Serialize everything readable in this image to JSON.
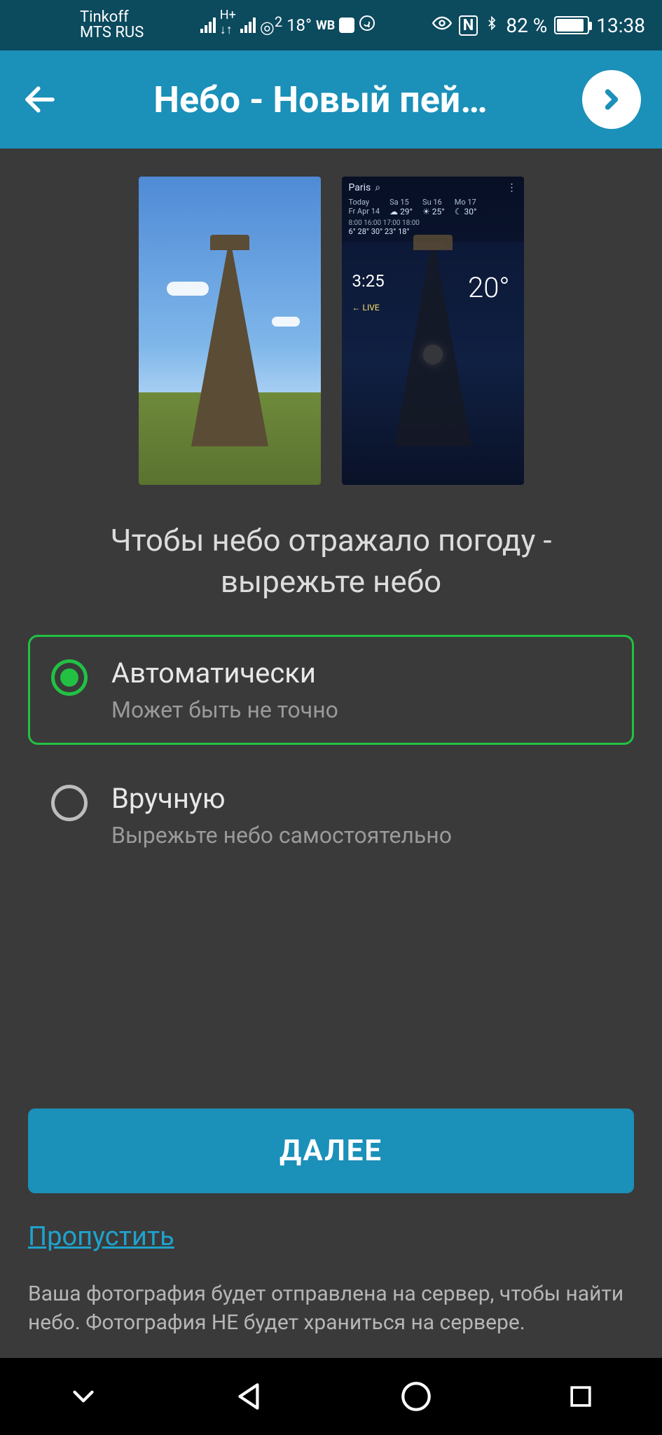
{
  "statusbar": {
    "carrier1": "Tinkoff",
    "carrier2": "MTS RUS",
    "temp_indicator": "18°",
    "wb_label": "WB",
    "battery_percent": "82 %",
    "time": "13:38",
    "aqi_badge_sup": "2"
  },
  "appbar": {
    "title": "Небо - Новый пей…"
  },
  "preview_night": {
    "location": "Paris",
    "today_label": "Today",
    "today_date": "Fr Apr 14",
    "days": [
      {
        "name": "Sa 15",
        "hi": "29°"
      },
      {
        "name": "Su 16",
        "hi": "25°"
      },
      {
        "name": "Mo 17",
        "hi": "30°"
      }
    ],
    "hours_row": "8:00   16:00   17:00   18:00",
    "hour_temps": "6° 28°  30°  23°  18°",
    "clock": "3:25",
    "live": "← LIVE",
    "big_temp": "20°"
  },
  "instruction": "Чтобы небо отражало погоду - вырежьте небо",
  "options": [
    {
      "title": "Автоматически",
      "sub": "Может быть не точно",
      "selected": true
    },
    {
      "title": "Вручную",
      "sub": "Вырежьте небо самостоятельно",
      "selected": false
    }
  ],
  "next_button": "ДАЛЕЕ",
  "skip_link": "Пропустить",
  "disclaimer": "Ваша фотография будет отправлена на сервер, чтобы найти небо. Фотография НЕ будет храниться на сервере."
}
